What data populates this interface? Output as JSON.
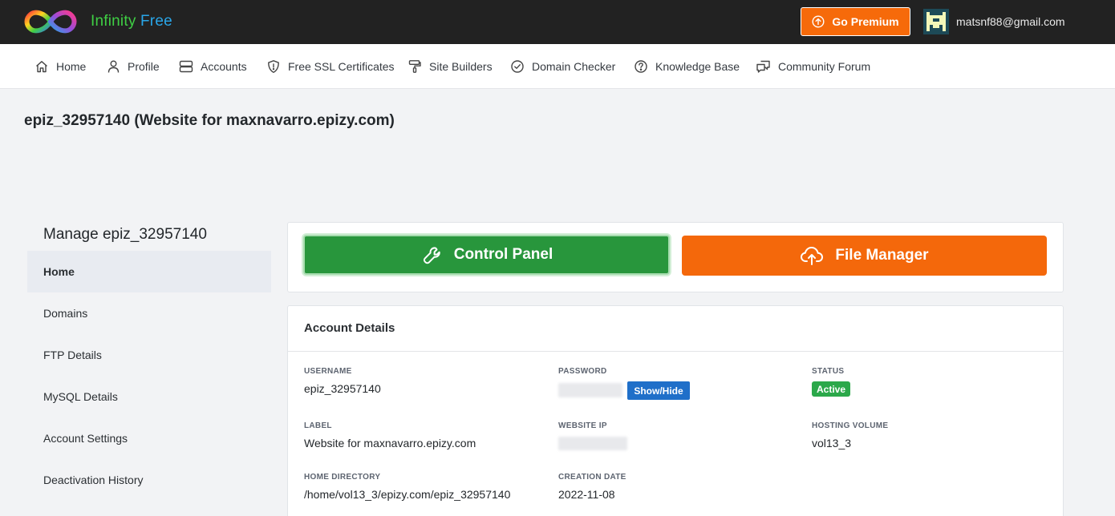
{
  "brand": {
    "name_part1": "Infinity",
    "name_part2": "Free",
    "logo_icon": "infinity-logo-icon"
  },
  "header": {
    "premium_label": "Go Premium",
    "premium_icon": "arrow-up-circle-icon",
    "user_email": "matsnf88@gmail.com",
    "avatar_icon": "pixel-avatar-icon"
  },
  "nav": [
    {
      "label": "Home",
      "icon": "home-icon"
    },
    {
      "label": "Profile",
      "icon": "user-icon"
    },
    {
      "label": "Accounts",
      "icon": "server-icon"
    },
    {
      "label": "Free SSL Certificates",
      "icon": "shield-icon"
    },
    {
      "label": "Site Builders",
      "icon": "paint-roller-icon"
    },
    {
      "label": "Domain Checker",
      "icon": "check-circle-icon"
    },
    {
      "label": "Knowledge Base",
      "icon": "help-circle-icon"
    },
    {
      "label": "Community Forum",
      "icon": "chat-icon"
    }
  ],
  "page_title": "epiz_32957140 (Website for maxnavarro.epizy.com)",
  "sidebar": {
    "title": "Manage epiz_32957140",
    "items": [
      {
        "label": "Home",
        "active": true
      },
      {
        "label": "Domains",
        "active": false
      },
      {
        "label": "FTP Details",
        "active": false
      },
      {
        "label": "MySQL Details",
        "active": false
      },
      {
        "label": "Account Settings",
        "active": false
      },
      {
        "label": "Deactivation History",
        "active": false
      }
    ]
  },
  "actions": {
    "control_panel_label": "Control Panel",
    "control_panel_icon": "wrench-icon",
    "file_manager_label": "File Manager",
    "file_manager_icon": "cloud-upload-icon"
  },
  "account_details": {
    "title": "Account Details",
    "username_label": "Username",
    "username": "epiz_32957140",
    "password_label": "Password",
    "show_hide_label": "Show/Hide",
    "status_label": "Status",
    "status": "Active",
    "label_label": "Label",
    "label": "Website for maxnavarro.epizy.com",
    "website_ip_label": "Website IP",
    "hosting_volume_label": "Hosting Volume",
    "hosting_volume": "vol13_3",
    "home_directory_label": "Home Directory",
    "home_directory": "/home/vol13_3/epizy.com/epiz_32957140",
    "creation_date_label": "Creation Date",
    "creation_date": "2022-11-08"
  },
  "colors": {
    "topbar": "#222222",
    "accent_orange": "#f4680b",
    "accent_green": "#28963c",
    "link_blue": "#1f6fc9",
    "brand_green": "#3fcf44",
    "brand_blue": "#2aa6e8"
  }
}
